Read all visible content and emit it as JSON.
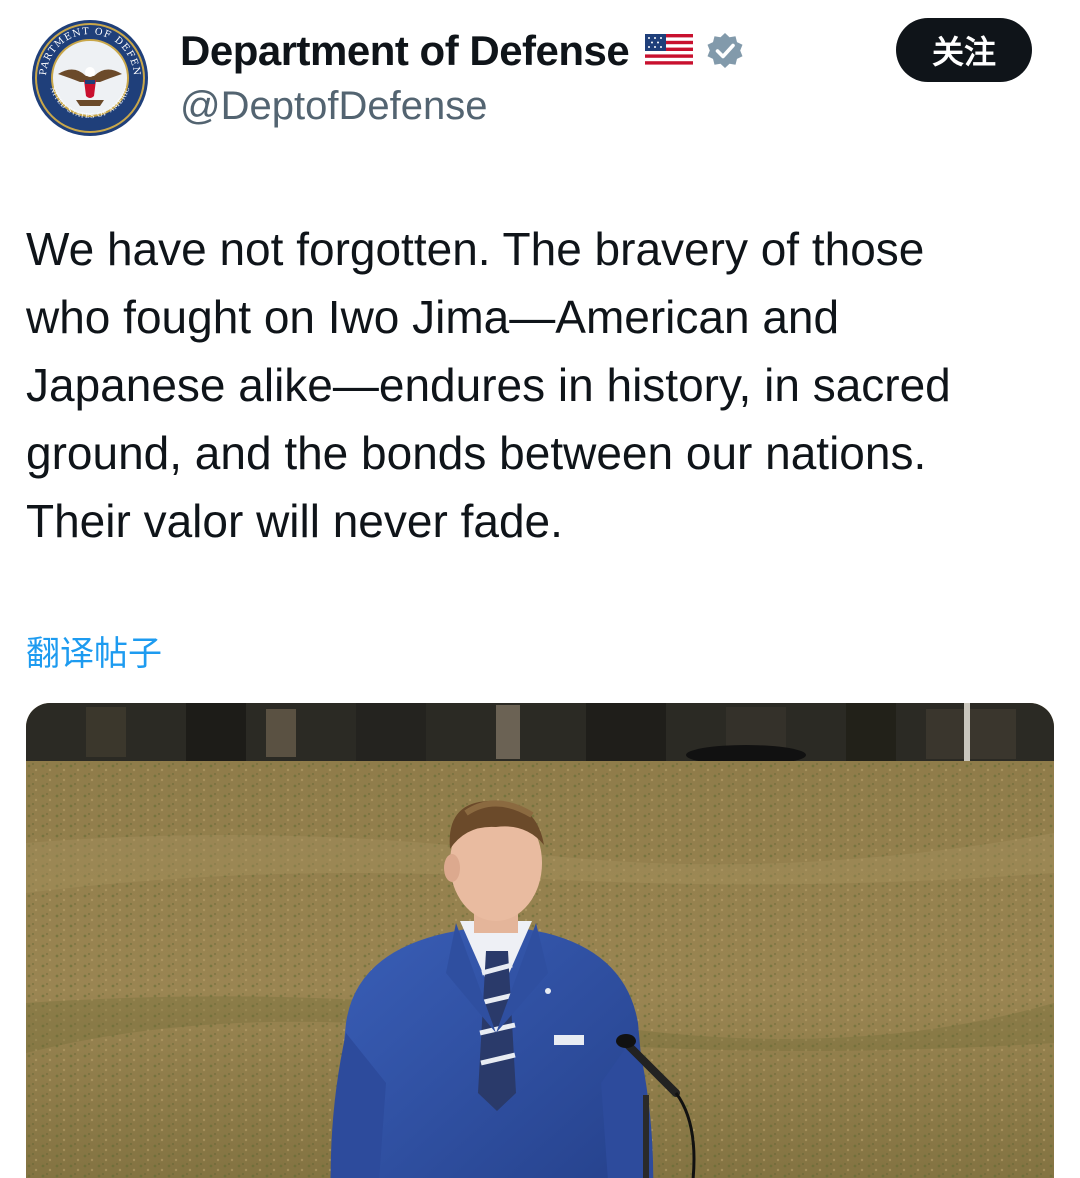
{
  "account": {
    "display_name": "Department of Defense",
    "handle": "@DeptofDefense",
    "avatar_icon": "department-of-defense-seal",
    "flag_icon": "us-flag-emoji",
    "verified_icon": "verified-gray-badge",
    "seal_text_top": "DEPARTMENT OF DEFENSE",
    "seal_text_bottom": "UNITED STATES OF AMERICA"
  },
  "actions": {
    "follow_label": "关注"
  },
  "tweet": {
    "text_lines": [
      "We have not forgotten. The bravery of those",
      "who fought on Iwo Jima—American and",
      "Japanese alike—endures in history, in sacred",
      "ground, and the bonds between our nations.",
      "Their valor will never fade."
    ],
    "translate_label": "翻译帖子"
  },
  "media": {
    "kind": "photo",
    "subject": "speaker-at-microphone-on-grass-field"
  },
  "colors": {
    "text_primary": "#0f1419",
    "text_secondary": "#536471",
    "link_blue": "#1d9bf0",
    "follow_bg": "#0f1419",
    "verified_gray": "#829aab"
  }
}
